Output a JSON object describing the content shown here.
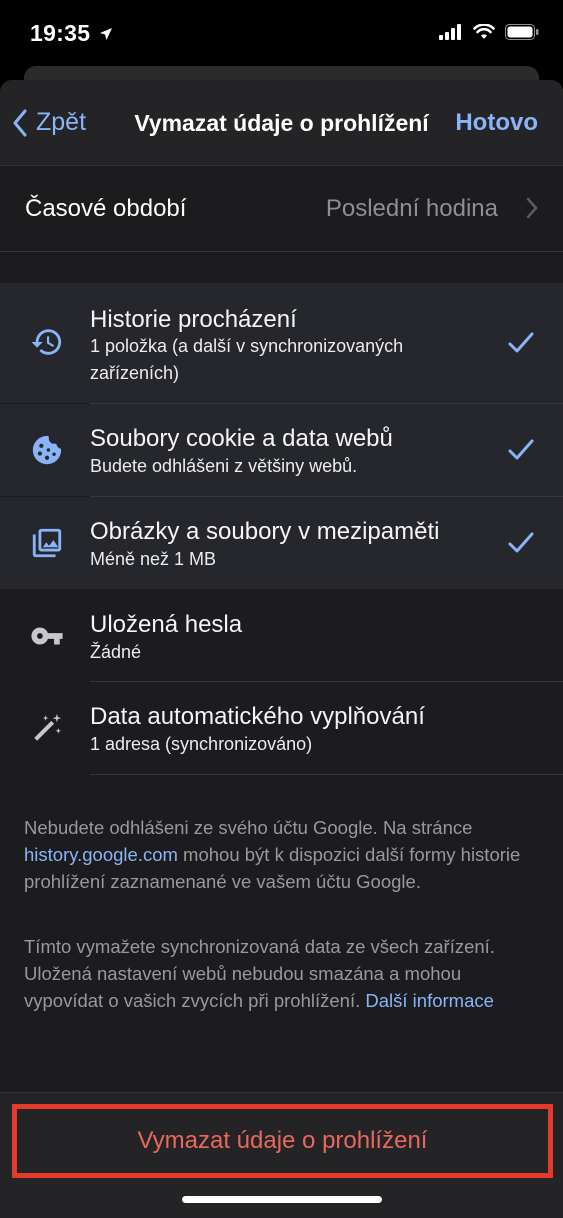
{
  "status": {
    "time": "19:35",
    "icons": [
      "location-arrow-icon",
      "cellular-signal-icon",
      "wifi-icon",
      "battery-icon"
    ]
  },
  "nav": {
    "back_label": "Zpět",
    "title": "Vymazat údaje o prohlížení",
    "done_label": "Hotovo"
  },
  "time_range": {
    "label": "Časové období",
    "value": "Poslední hodina"
  },
  "items": [
    {
      "title": "Historie procházení",
      "subtitle": "1 položka (a další v synchronizovaných zařízeních)",
      "checked": true,
      "icon": "history-icon"
    },
    {
      "title": "Soubory cookie a data webů",
      "subtitle": "Budete odhlášeni z většiny webů.",
      "checked": true,
      "icon": "cookie-icon"
    },
    {
      "title": "Obrázky a soubory v mezipaměti",
      "subtitle": "Méně než 1 MB",
      "checked": true,
      "icon": "image-cache-icon"
    },
    {
      "title": "Uložená hesla",
      "subtitle": "Žádné",
      "checked": false,
      "icon": "key-icon"
    },
    {
      "title": "Data automatického vyplňování",
      "subtitle": "1 adresa (synchronizováno)",
      "checked": false,
      "icon": "magic-wand-icon"
    }
  ],
  "footnotes": {
    "note1_before": "Nebudete odhlášeni ze svého účtu Google. Na stránce ",
    "note1_link": "history.google.com",
    "note1_after": " mohou být k dispozici další formy historie prohlížení zaznamenané ve vašem účtu Google.",
    "note2_text": "Tímto vymažete synchronizovaná data ze všech zařízení. Uložená nastavení webů nebudou smazána a mohou vypovídat o vašich zvycích při prohlížení. ",
    "note2_link": "Další informace"
  },
  "clear_button": "Vymazat údaje o prohlížení",
  "colors": {
    "accent": "#8ab4f8",
    "destructive": "#e8685e",
    "highlight_border": "#e5392b"
  }
}
